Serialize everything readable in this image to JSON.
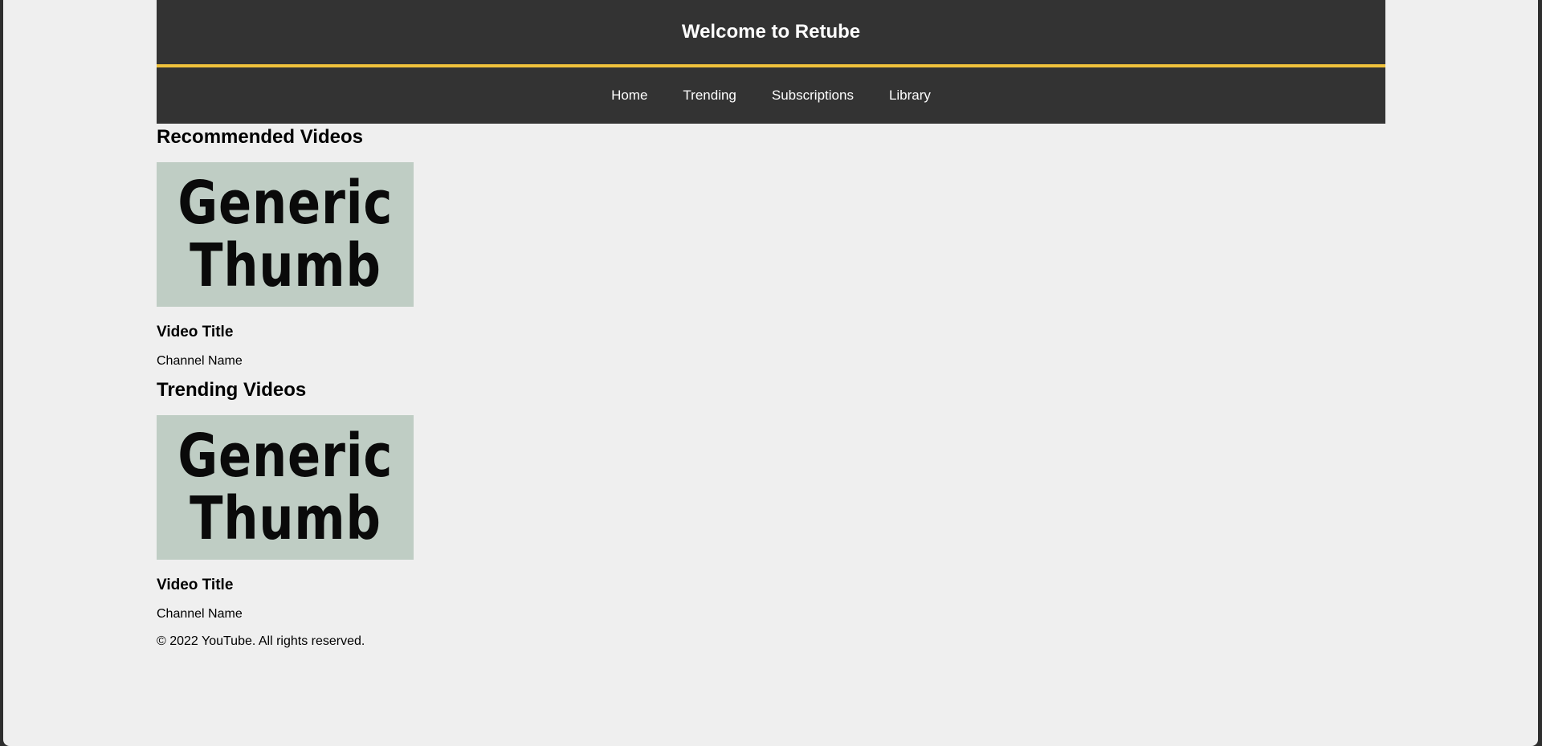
{
  "header": {
    "title": "Welcome to Retube"
  },
  "nav": {
    "items": [
      {
        "label": "Home"
      },
      {
        "label": "Trending"
      },
      {
        "label": "Subscriptions"
      },
      {
        "label": "Library"
      }
    ]
  },
  "sections": [
    {
      "heading": "Recommended Videos",
      "video": {
        "thumb_line1": "Generic",
        "thumb_line2": "Thumb",
        "title": "Video Title",
        "channel": "Channel Name"
      }
    },
    {
      "heading": "Trending Videos",
      "video": {
        "thumb_line1": "Generic",
        "thumb_line2": "Thumb",
        "title": "Video Title",
        "channel": "Channel Name"
      }
    }
  ],
  "footer": {
    "text": "© 2022 YouTube. All rights reserved."
  },
  "colors": {
    "header_bg": "#333333",
    "accent": "#f0c23c",
    "page_bg": "#efefef",
    "thumb_bg": "#bfcdc4"
  }
}
